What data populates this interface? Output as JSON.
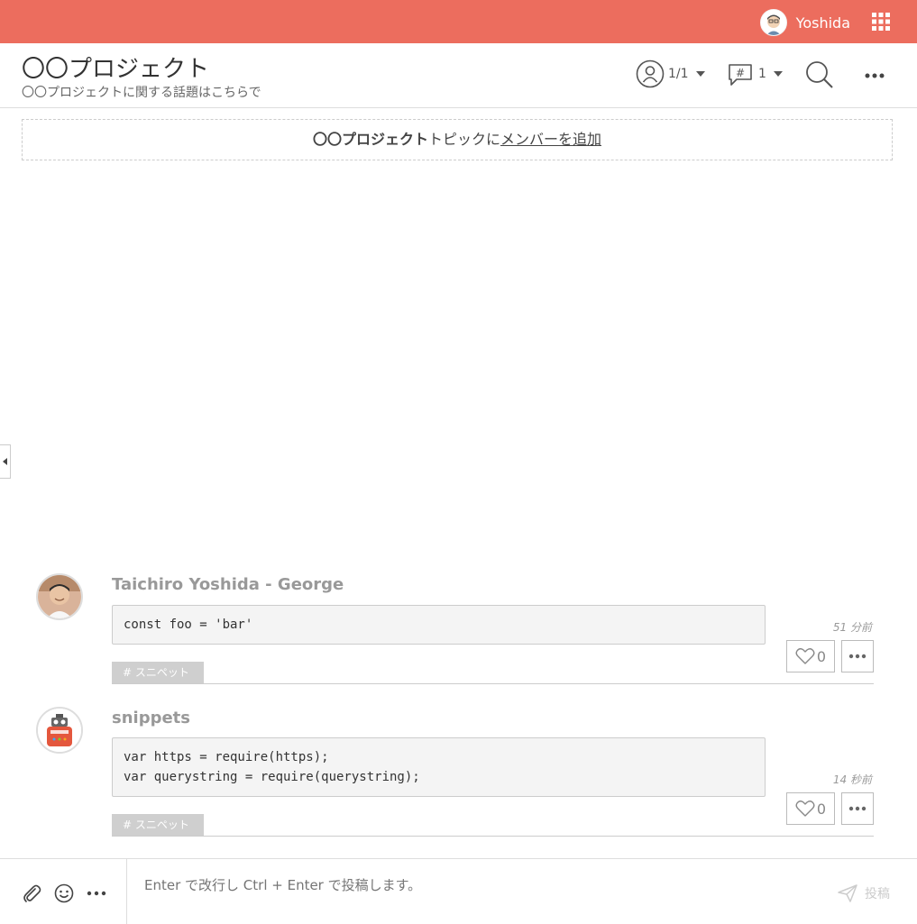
{
  "topbar": {
    "username": "Yoshida",
    "icons": {
      "avatar": "user-avatar",
      "apps": "grid-icon"
    },
    "color": "#ec6d5e"
  },
  "header": {
    "title": "〇〇プロジェクト",
    "description": "〇〇プロジェクトに関する話題はこちらで",
    "members_count": "1/1",
    "topics_count": "1",
    "icons": {
      "members": "user-icon",
      "topics": "hashtag-bubble-icon",
      "search": "search-icon",
      "more": "more-icon"
    }
  },
  "banner": {
    "project": "〇〇プロジェクト",
    "middle": "トピックに",
    "link": "メンバーを追加"
  },
  "messages": [
    {
      "author": "Taichiro Yoshida - George",
      "code": "const foo = 'bar'",
      "time": "51 分前",
      "likes": "0",
      "tag": "# スニペット"
    },
    {
      "author": "snippets",
      "code": "var https = require(https);\nvar querystring = require(querystring);",
      "time": "14 秒前",
      "likes": "0",
      "tag": "# スニペット"
    }
  ],
  "composer": {
    "placeholder": "Enter で改行し Ctrl + Enter で投稿します。",
    "send_label": "投稿",
    "icons": [
      "paperclip-icon",
      "smiley-icon",
      "more-icon",
      "send-icon"
    ]
  }
}
